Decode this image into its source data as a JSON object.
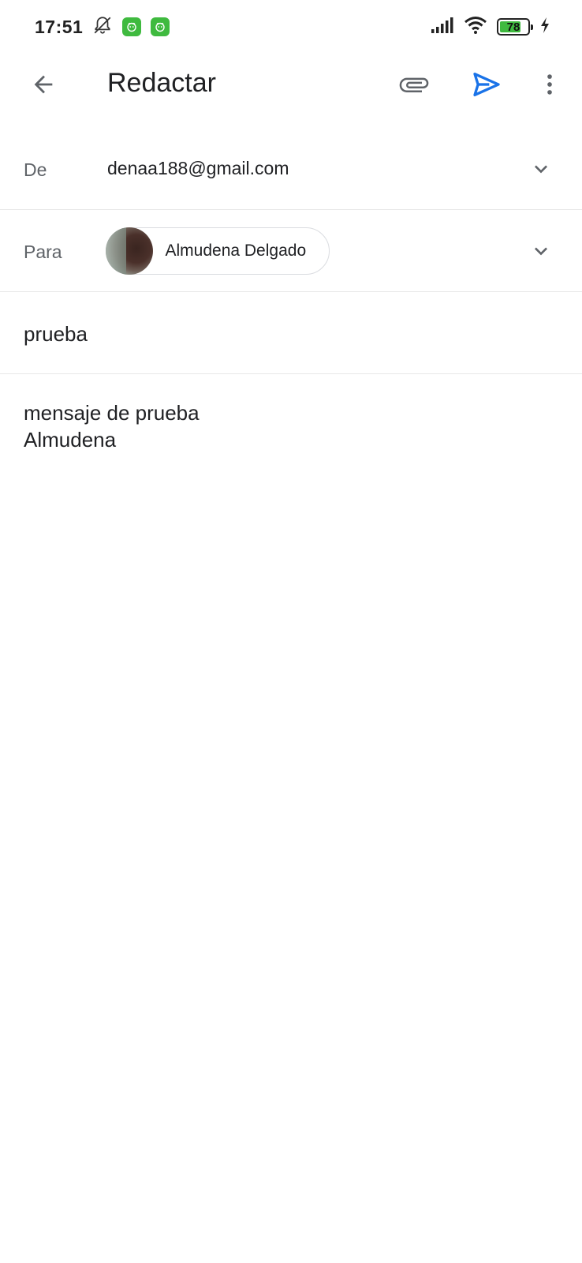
{
  "status_bar": {
    "time": "17:51",
    "battery_level": "78",
    "battery_fraction": 0.78,
    "icons": [
      "bell-off-icon",
      "app-badge-icon",
      "app-badge-icon",
      "signal-icon",
      "wifi-icon",
      "battery-icon",
      "charging-icon"
    ]
  },
  "app_bar": {
    "title": "Redactar",
    "icons": [
      "back-arrow-icon",
      "attach-icon",
      "send-icon",
      "more-vert-icon"
    ],
    "send_color": "#1a73e8"
  },
  "from": {
    "label": "De",
    "value": "denaa188@gmail.com"
  },
  "to": {
    "label": "Para",
    "recipient_name": "Almudena Delgado"
  },
  "subject": {
    "value": "prueba"
  },
  "body": {
    "lines": [
      "mensaje de prueba",
      "Almudena"
    ]
  }
}
